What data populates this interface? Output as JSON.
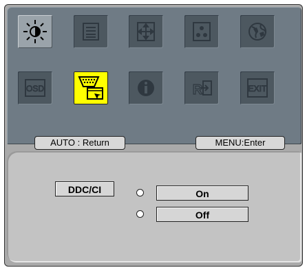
{
  "menu": {
    "icons": [
      {
        "name": "brightness-icon",
        "state": "active"
      },
      {
        "name": "image-settings-icon",
        "state": "normal"
      },
      {
        "name": "position-icon",
        "state": "normal"
      },
      {
        "name": "color-icon",
        "state": "normal"
      },
      {
        "name": "language-icon",
        "state": "normal"
      },
      {
        "name": "osd-icon",
        "state": "normal"
      },
      {
        "name": "ddc-ci-icon",
        "state": "selected"
      },
      {
        "name": "information-icon",
        "state": "normal"
      },
      {
        "name": "reset-icon",
        "state": "normal"
      },
      {
        "name": "exit-icon",
        "state": "normal"
      }
    ],
    "auto_hint": "AUTO : Return",
    "menu_hint": "MENU:Enter"
  },
  "submenu": {
    "label": "DDC/CI",
    "options": [
      {
        "label": "On",
        "selected": false
      },
      {
        "label": "Off",
        "selected": false
      }
    ]
  },
  "colors": {
    "panel": "#6f7b85",
    "tile": "#4d5860",
    "selected_tile": "#ffff00",
    "submenu_panel": "#c3c3c3"
  }
}
